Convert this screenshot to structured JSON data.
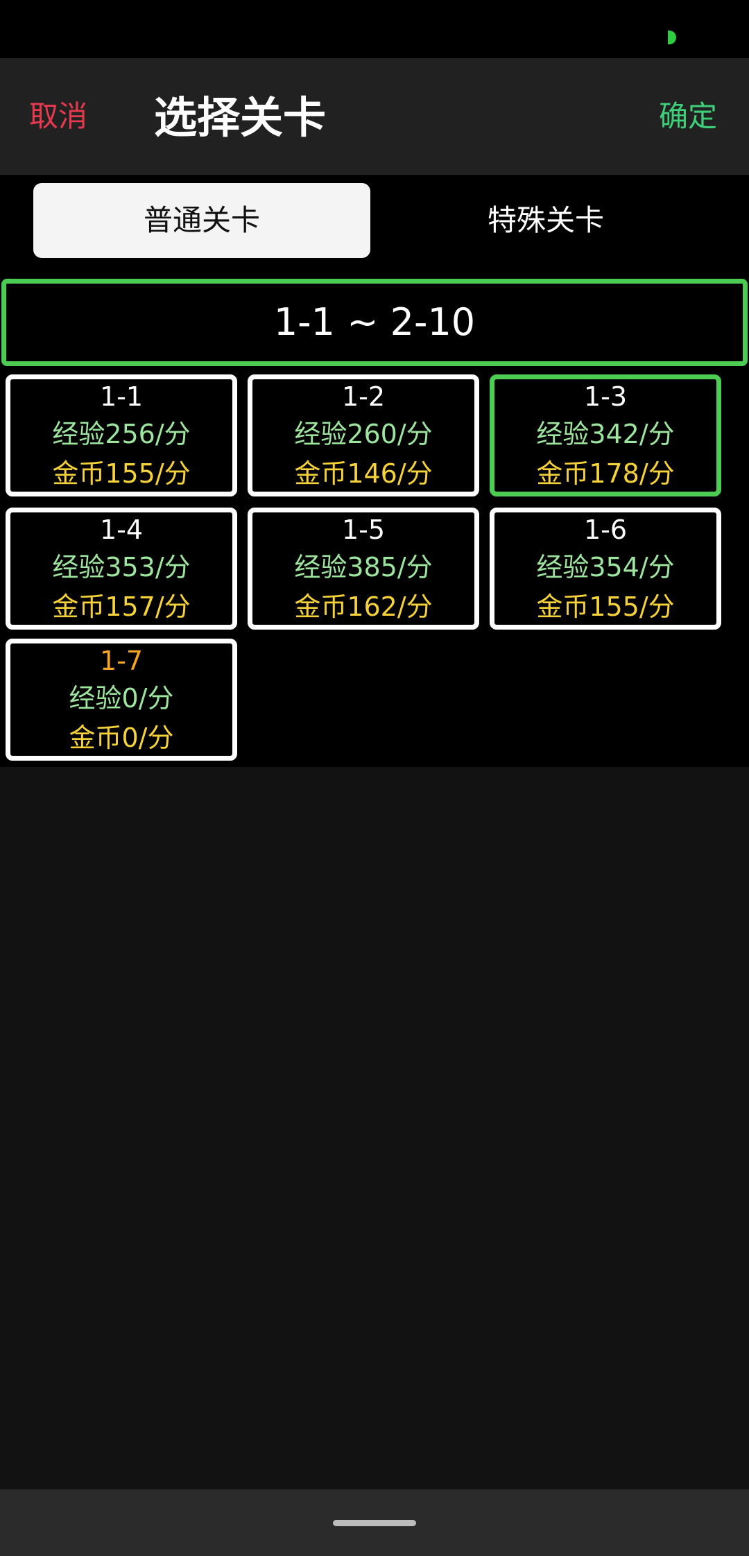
{
  "header": {
    "cancel_label": "取消",
    "title": "选择关卡",
    "confirm_label": "确定"
  },
  "tabs": [
    {
      "label": "普通关卡",
      "active": true
    },
    {
      "label": "特殊关卡",
      "active": false
    }
  ],
  "range": {
    "label": "1-1 ~ 2-10"
  },
  "levels": [
    {
      "name": "1-1",
      "exp": "经验256/分",
      "gold": "金币155/分",
      "selected": false
    },
    {
      "name": "1-2",
      "exp": "经验260/分",
      "gold": "金币146/分",
      "selected": false
    },
    {
      "name": "1-3",
      "exp": "经验342/分",
      "gold": "金币178/分",
      "selected": true
    },
    {
      "name": "1-4",
      "exp": "经验353/分",
      "gold": "金币157/分",
      "selected": false
    },
    {
      "name": "1-5",
      "exp": "经验385/分",
      "gold": "金币162/分",
      "selected": false
    },
    {
      "name": "1-6",
      "exp": "经验354/分",
      "gold": "金币155/分",
      "selected": false
    },
    {
      "name": "1-7",
      "exp": "经验0/分",
      "gold": "金币0/分",
      "selected": false
    }
  ],
  "colors": {
    "cancel": "#e53950",
    "confirm": "#3ecf78",
    "selected_border": "#4ccc52",
    "exp_text": "#9de59e",
    "gold_text": "#f5d23a",
    "locked_level_name": "#f5a524"
  }
}
